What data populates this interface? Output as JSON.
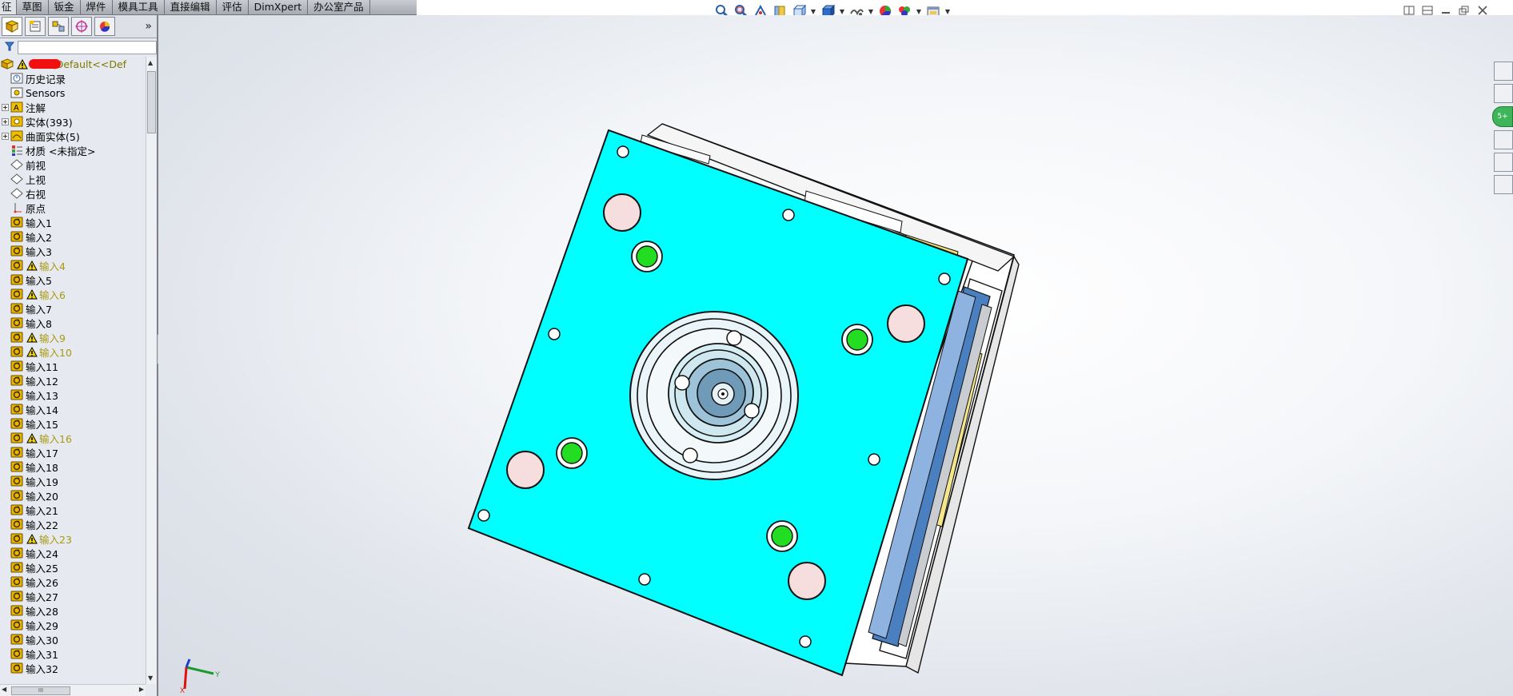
{
  "command_tabs": [
    "征",
    "草图",
    "钣金",
    "焊件",
    "模具工具",
    "直接编辑",
    "评估",
    "DimXpert",
    "办公室产品"
  ],
  "panel": {
    "expand_label": "»",
    "root": {
      "label": "381  (Default<<Def"
    },
    "items": [
      {
        "label": "历史记录",
        "icon": "history-icon",
        "expand": false,
        "warn": false
      },
      {
        "label": "Sensors",
        "icon": "sensors-icon",
        "expand": false,
        "warn": false
      },
      {
        "label": "注解",
        "icon": "annotations-icon",
        "expand": true,
        "warn": false
      },
      {
        "label": "实体(393)",
        "icon": "solid-bodies-icon",
        "expand": true,
        "warn": false
      },
      {
        "label": "曲面实体(5)",
        "icon": "surface-bodies-icon",
        "expand": true,
        "warn": false
      },
      {
        "label": "材质 <未指定>",
        "icon": "material-icon",
        "expand": false,
        "warn": false
      },
      {
        "label": "前视",
        "icon": "plane-icon",
        "expand": false,
        "warn": false
      },
      {
        "label": "上视",
        "icon": "plane-icon",
        "expand": false,
        "warn": false
      },
      {
        "label": "右视",
        "icon": "plane-icon",
        "expand": false,
        "warn": false
      },
      {
        "label": "原点",
        "icon": "origin-icon",
        "expand": false,
        "warn": false
      },
      {
        "label": "输入1",
        "icon": "import-feature-icon",
        "expand": false,
        "warn": false
      },
      {
        "label": "输入2",
        "icon": "import-feature-icon",
        "expand": false,
        "warn": false
      },
      {
        "label": "输入3",
        "icon": "import-feature-icon",
        "expand": false,
        "warn": false
      },
      {
        "label": "输入4",
        "icon": "import-feature-icon",
        "expand": false,
        "warn": true
      },
      {
        "label": "输入5",
        "icon": "import-feature-icon",
        "expand": false,
        "warn": false
      },
      {
        "label": "输入6",
        "icon": "import-feature-icon",
        "expand": false,
        "warn": true
      },
      {
        "label": "输入7",
        "icon": "import-feature-icon",
        "expand": false,
        "warn": false
      },
      {
        "label": "输入8",
        "icon": "import-feature-icon",
        "expand": false,
        "warn": false
      },
      {
        "label": "输入9",
        "icon": "import-feature-icon",
        "expand": false,
        "warn": true
      },
      {
        "label": "输入10",
        "icon": "import-feature-icon",
        "expand": false,
        "warn": true
      },
      {
        "label": "输入11",
        "icon": "import-feature-icon",
        "expand": false,
        "warn": false
      },
      {
        "label": "输入12",
        "icon": "import-feature-icon",
        "expand": false,
        "warn": false
      },
      {
        "label": "输入13",
        "icon": "import-feature-icon",
        "expand": false,
        "warn": false
      },
      {
        "label": "输入14",
        "icon": "import-feature-icon",
        "expand": false,
        "warn": false
      },
      {
        "label": "输入15",
        "icon": "import-feature-icon",
        "expand": false,
        "warn": false
      },
      {
        "label": "输入16",
        "icon": "import-feature-icon",
        "expand": false,
        "warn": true
      },
      {
        "label": "输入17",
        "icon": "import-feature-icon",
        "expand": false,
        "warn": false
      },
      {
        "label": "输入18",
        "icon": "import-feature-icon",
        "expand": false,
        "warn": false
      },
      {
        "label": "输入19",
        "icon": "import-feature-icon",
        "expand": false,
        "warn": false
      },
      {
        "label": "输入20",
        "icon": "import-feature-icon",
        "expand": false,
        "warn": false
      },
      {
        "label": "输入21",
        "icon": "import-feature-icon",
        "expand": false,
        "warn": false
      },
      {
        "label": "输入22",
        "icon": "import-feature-icon",
        "expand": false,
        "warn": false
      },
      {
        "label": "输入23",
        "icon": "import-feature-icon",
        "expand": false,
        "warn": true
      },
      {
        "label": "输入24",
        "icon": "import-feature-icon",
        "expand": false,
        "warn": false
      },
      {
        "label": "输入25",
        "icon": "import-feature-icon",
        "expand": false,
        "warn": false
      },
      {
        "label": "输入26",
        "icon": "import-feature-icon",
        "expand": false,
        "warn": false
      },
      {
        "label": "输入27",
        "icon": "import-feature-icon",
        "expand": false,
        "warn": false
      },
      {
        "label": "输入28",
        "icon": "import-feature-icon",
        "expand": false,
        "warn": false
      },
      {
        "label": "输入29",
        "icon": "import-feature-icon",
        "expand": false,
        "warn": false
      },
      {
        "label": "输入30",
        "icon": "import-feature-icon",
        "expand": false,
        "warn": false
      },
      {
        "label": "输入31",
        "icon": "import-feature-icon",
        "expand": false,
        "warn": false
      },
      {
        "label": "输入32",
        "icon": "import-feature-icon",
        "expand": false,
        "warn": false
      }
    ]
  },
  "scroll": {
    "h_thumb_label": "III"
  },
  "triad": {
    "x_label": "X",
    "y_label": "Y"
  },
  "colors": {
    "plate": "#00ffff",
    "boss_fill": "#f7dede",
    "guide_pin": "#22dd22",
    "warning": "#f2d200",
    "feature_icon": "#e8b400",
    "side_blue": "#4a7fc0"
  }
}
